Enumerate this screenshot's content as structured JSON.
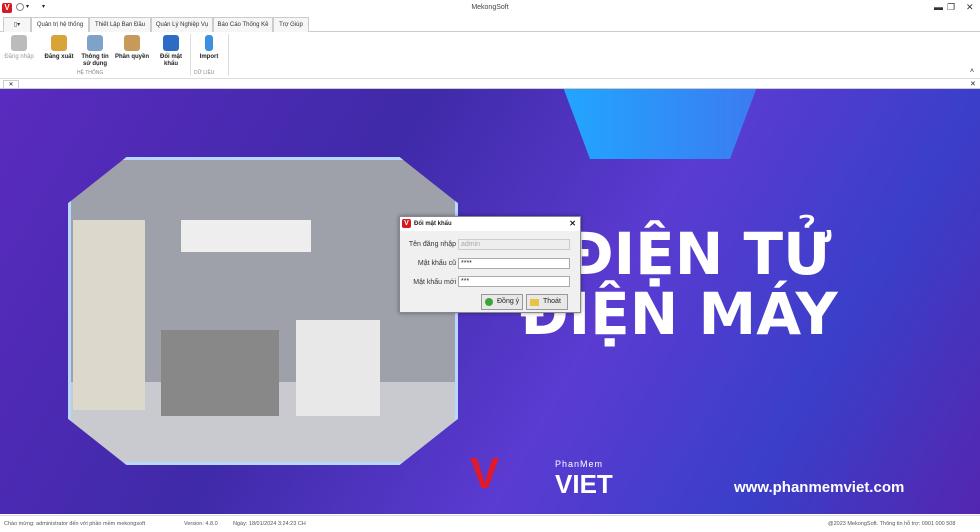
{
  "app": {
    "title": "MekongSoft"
  },
  "tabs": [
    "Quản trị hệ thống",
    "Thiết Lập Ban Đầu",
    "Quản Lý Nghiệp Vụ",
    "Báo Cáo Thống Kê",
    "Trợ Giúp"
  ],
  "ribbon": {
    "buttons": [
      "Đăng nhập",
      "Đăng xuất",
      "Thông tin sử dụng",
      "Phân quyền",
      "Đổi mật khẩu",
      "Import"
    ],
    "groups": [
      "HỆ THỐNG",
      "DỮ LIỆU"
    ]
  },
  "banner": {
    "line1": "ĐIỆN TỬ",
    "line2": "ĐIỆN MÁY",
    "brand_small": "PhanMem",
    "brand_big": "VIET",
    "url": "www.phanmemviet.com"
  },
  "dialog": {
    "title": "Đổi mật khẩu",
    "username_label": "Tên đăng nhập",
    "username_value": "admin",
    "old_label": "Mật khẩu cũ",
    "old_value": "****",
    "new_label": "Mật khẩu mới",
    "new_value": "***",
    "ok": "Đồng ý",
    "exit": "Thoát"
  },
  "status": {
    "welcome": "Chào mừng: administrator đến với phần mềm mekongsoft",
    "version": "Version: 4.8.0",
    "date": "Ngày: 18/01/2024 3:24:23 CH",
    "copyright": "@2023 MekongSoft. Thông tin hỗ trợ: 0901 000 508"
  },
  "colors": {
    "accent": "#d71920",
    "banner": "#4a2bb8"
  }
}
